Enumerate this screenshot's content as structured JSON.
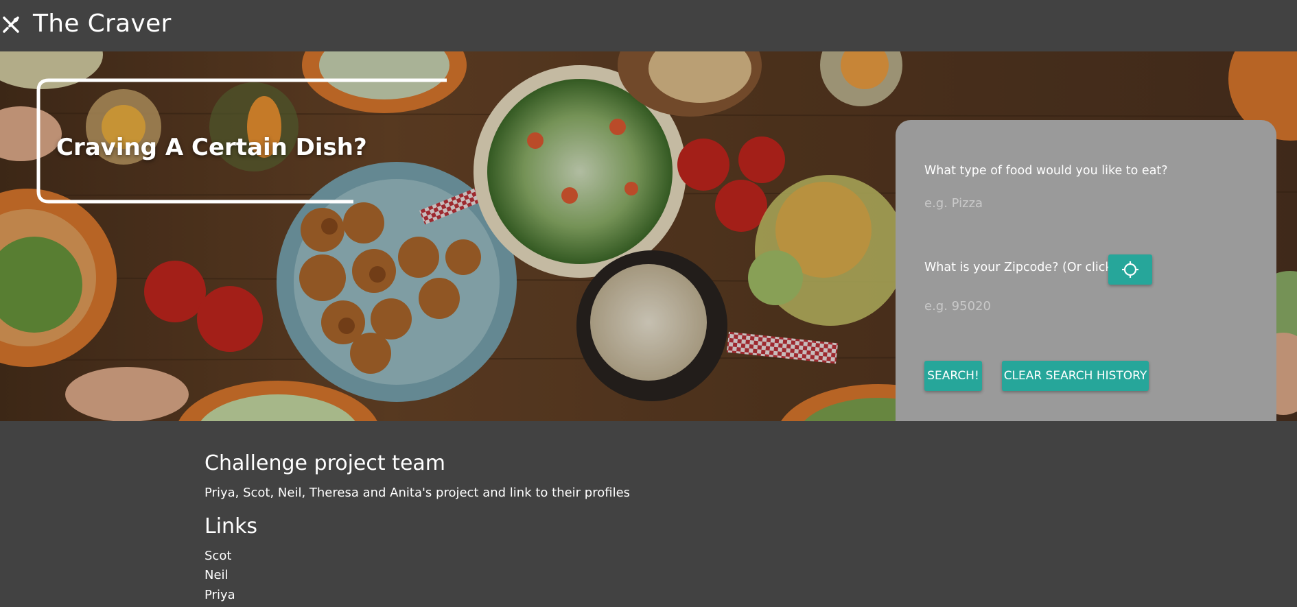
{
  "nav": {
    "brand": "The Craver",
    "icon": "utensils-icon"
  },
  "hero": {
    "headline": "Craving A Certain Dish?"
  },
  "search_form": {
    "food_label": "What type of food would you like to eat?",
    "food_placeholder": "e.g. Pizza",
    "zip_label": "What is your Zipcode? (Or click)",
    "locate_icon": "crosshair-icon",
    "zip_placeholder": "e.g. 95020",
    "search_button": "SEARCH!",
    "clear_button": "CLEAR SEARCH HISTORY"
  },
  "footer": {
    "team_heading": "Challenge project team",
    "team_text": "Priya, Scot, Neil, Theresa and Anita's project and link to their profiles",
    "links_heading": "Links",
    "links": [
      "Scot",
      "Neil",
      "Priya"
    ]
  },
  "colors": {
    "background": "#424242",
    "accent": "#26a69a",
    "card": "#9a9a9a"
  }
}
